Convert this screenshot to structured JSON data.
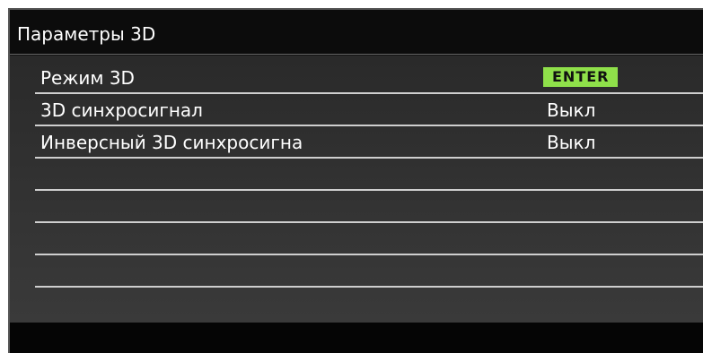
{
  "header": {
    "title": "Параметры 3D"
  },
  "menu": {
    "items": [
      {
        "label": "Режим 3D",
        "value": "ENTER"
      },
      {
        "label": "3D синхросигнал",
        "value": "Выкл"
      },
      {
        "label": "Инверсный 3D синхросигна",
        "value": "Выкл"
      },
      {
        "label": "",
        "value": ""
      },
      {
        "label": "",
        "value": ""
      },
      {
        "label": "",
        "value": ""
      },
      {
        "label": "",
        "value": ""
      }
    ]
  },
  "colors": {
    "accent": "#8fe04a",
    "background": "#111111",
    "text": "#ffffff",
    "divider": "#cfcfcf"
  }
}
